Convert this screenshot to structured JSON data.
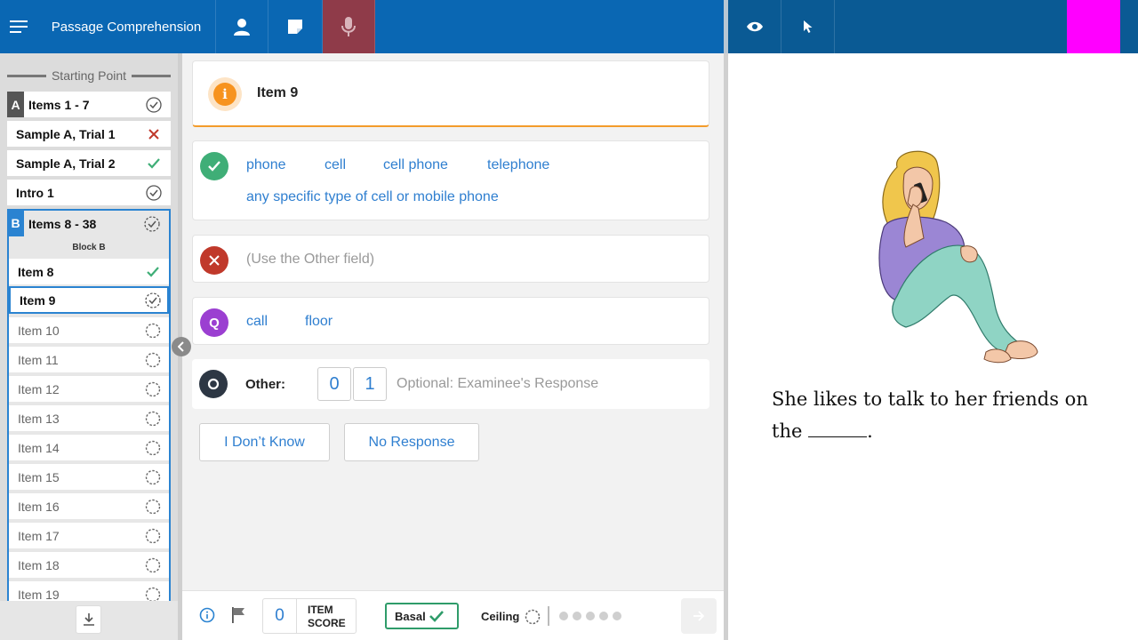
{
  "header": {
    "title": "Passage Comprehension",
    "icons": [
      "menu-icon",
      "person-icon",
      "note-icon",
      "microphone-icon",
      "eye-icon",
      "cursor-icon"
    ]
  },
  "sidebar": {
    "starting_point": "Starting Point",
    "block_a": {
      "letter": "A",
      "label": "Items 1 - 7",
      "status": "complete"
    },
    "rows": [
      {
        "label": "Sample A, Trial 1",
        "status": "incorrect"
      },
      {
        "label": "Sample A, Trial 2",
        "status": "correct"
      },
      {
        "label": "Intro 1",
        "status": "complete"
      }
    ],
    "block_b": {
      "letter": "B",
      "label": "Items 8 - 38",
      "subtitle": "Block B",
      "status": "in-progress"
    },
    "items": [
      {
        "label": "Item 8",
        "status": "correct"
      },
      {
        "label": "Item 9",
        "status": "current"
      },
      {
        "label": "Item 10",
        "status": "pending"
      },
      {
        "label": "Item 11",
        "status": "pending"
      },
      {
        "label": "Item 12",
        "status": "pending"
      },
      {
        "label": "Item 13",
        "status": "pending"
      },
      {
        "label": "Item 14",
        "status": "pending"
      },
      {
        "label": "Item 15",
        "status": "pending"
      },
      {
        "label": "Item 16",
        "status": "pending"
      },
      {
        "label": "Item 17",
        "status": "pending"
      },
      {
        "label": "Item 18",
        "status": "pending"
      },
      {
        "label": "Item 19",
        "status": "pending"
      }
    ]
  },
  "item": {
    "title": "Item 9",
    "correct_answers_row1": [
      "phone",
      "cell",
      "cell phone",
      "telephone"
    ],
    "correct_answers_row2": "any specific type of cell or mobile phone",
    "incorrect_note": "(Use the Other field)",
    "query_answers": [
      "call",
      "floor"
    ],
    "other_label": "Other:",
    "score_options": [
      "0",
      "1"
    ],
    "response_placeholder": "Optional: Examinee's Response",
    "dont_know_label": "I Don’t Know",
    "no_response_label": "No Response"
  },
  "footer": {
    "item_score_value": "0",
    "item_score_label_1": "ITEM",
    "item_score_label_2": "SCORE",
    "basal_label": "Basal",
    "ceiling_label": "Ceiling"
  },
  "passage": {
    "sentence": "She likes to talk to her friends on the",
    "sentence_end": "."
  },
  "colors": {
    "header_blue": "#0a67b3",
    "right_header_blue": "#0a5a94",
    "mic_active": "#8f3b49",
    "magenta": "#ff00ff",
    "correct_green": "#3fae77",
    "incorrect_red": "#c0392b",
    "query_purple": "#9b3fd1",
    "other_dark": "#2d3744",
    "answer_blue": "#2f7fd0",
    "info_orange": "#f7931e"
  }
}
